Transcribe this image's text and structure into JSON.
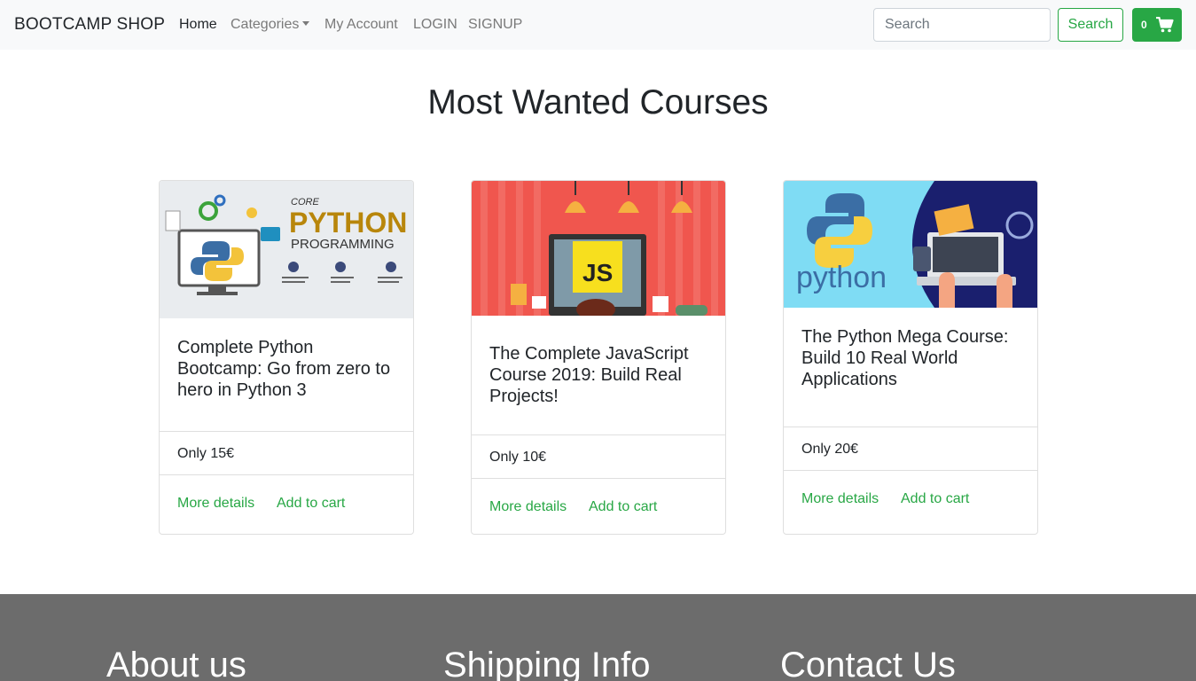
{
  "navbar": {
    "brand": "BOOTCAMP SHOP",
    "links": {
      "home": "Home",
      "categories": "Categories",
      "account": "My Account",
      "login": "LOGIN",
      "signup": "SIGNUP"
    },
    "search": {
      "placeholder": "Search",
      "value": "",
      "button_label": "Search"
    },
    "cart": {
      "count": "0",
      "icon": "shopping-cart-icon"
    }
  },
  "main": {
    "title": "Most Wanted Courses",
    "courses": [
      {
        "title": "Complete Python Bootcamp: Go from zero to hero in Python 3",
        "price": "Only 15€",
        "more_label": "More details",
        "cart_label": "Add to cart",
        "image_text": {
          "small": "CORE",
          "big": "PYTHON",
          "sub": "PROGRAMMING"
        }
      },
      {
        "title": "The Complete JavaScript Course 2019: Build Real Projects!",
        "price": "Only 10€",
        "more_label": "More details",
        "cart_label": "Add to cart",
        "image_text": {
          "badge": "JS"
        }
      },
      {
        "title": "The Python Mega Course: Build 10 Real World Applications",
        "price": "Only 20€",
        "more_label": "More details",
        "cart_label": "Add to cart",
        "image_text": {
          "word": "python"
        }
      }
    ]
  },
  "footer": {
    "about": "About us",
    "shipping": "Shipping Info",
    "contact": "Contact Us"
  },
  "colors": {
    "accent": "#28a745",
    "navbar_bg": "#f8f9fa",
    "footer_bg": "#6c6c6c"
  }
}
